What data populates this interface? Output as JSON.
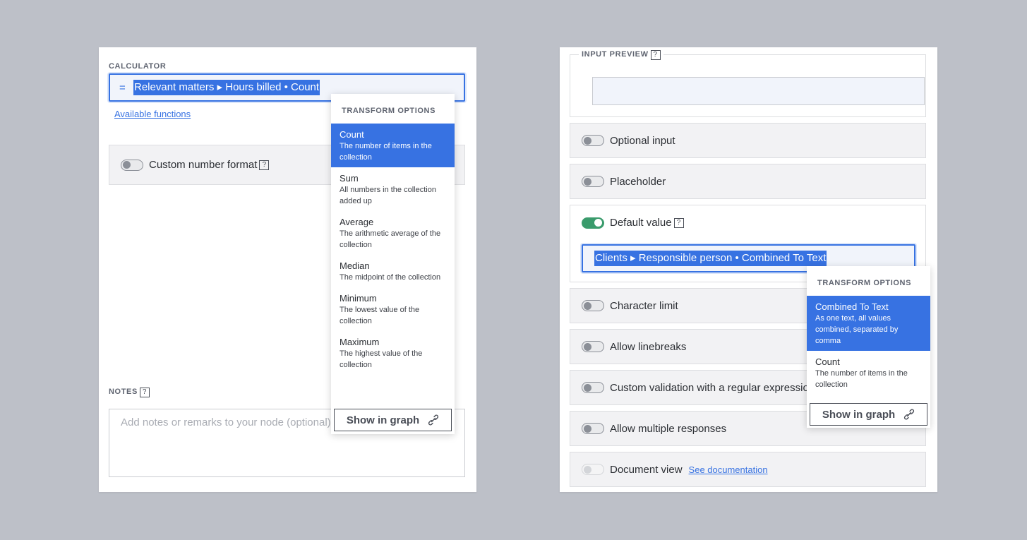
{
  "calculator": {
    "label": "CALCULATOR",
    "eq_sign": "=",
    "formula": "Relevant matters ▸ Hours billed • Count",
    "available_functions": "Available functions",
    "custom_number_format": "Custom number format",
    "help": "?"
  },
  "notes": {
    "label": "NOTES",
    "placeholder": "Add notes or remarks to your node (optional)",
    "help": "?"
  },
  "transform_left": {
    "header": "TRANSFORM OPTIONS",
    "items": [
      {
        "title": "Count",
        "desc": "The number of items in the collection"
      },
      {
        "title": "Sum",
        "desc": "All numbers in the collection added up"
      },
      {
        "title": "Average",
        "desc": "The arithmetic average of the collection"
      },
      {
        "title": "Median",
        "desc": "The midpoint of the collection"
      },
      {
        "title": "Minimum",
        "desc": "The lowest value of the collection"
      },
      {
        "title": "Maximum",
        "desc": "The highest value of the collection"
      }
    ],
    "selected": "Count",
    "show_in_graph": "Show in graph"
  },
  "input_preview": {
    "label": "INPUT PREVIEW",
    "help": "?"
  },
  "options": {
    "optional_input": "Optional input",
    "placeholder": "Placeholder",
    "default_value": "Default value",
    "default_value_help": "?",
    "default_value_formula": "Clients ▸ Responsible person • Combined To Text",
    "character_limit": "Character limit",
    "allow_linebreaks": "Allow linebreaks",
    "custom_validation": "Custom validation with a regular expression",
    "allow_multiple": "Allow multiple responses",
    "document_view": "Document view",
    "see_documentation": "See documentation"
  },
  "toggle_states": {
    "custom_number_format": "off",
    "optional_input": "off",
    "placeholder": "off",
    "default_value": "on",
    "character_limit": "off",
    "allow_linebreaks": "off",
    "custom_validation": "off",
    "allow_multiple": "off",
    "document_view": "disabled"
  },
  "transform_right": {
    "header": "TRANSFORM OPTIONS",
    "items": [
      {
        "title": "Combined To Text",
        "desc": "As one text, all values combined, separated by comma"
      },
      {
        "title": "Count",
        "desc": "The number of items in the collection"
      }
    ],
    "selected": "Combined To Text",
    "show_in_graph": "Show in graph"
  },
  "colors": {
    "background": "#bdc0c8",
    "accent": "#3772e2",
    "toggle_on": "#3a9b6c"
  }
}
